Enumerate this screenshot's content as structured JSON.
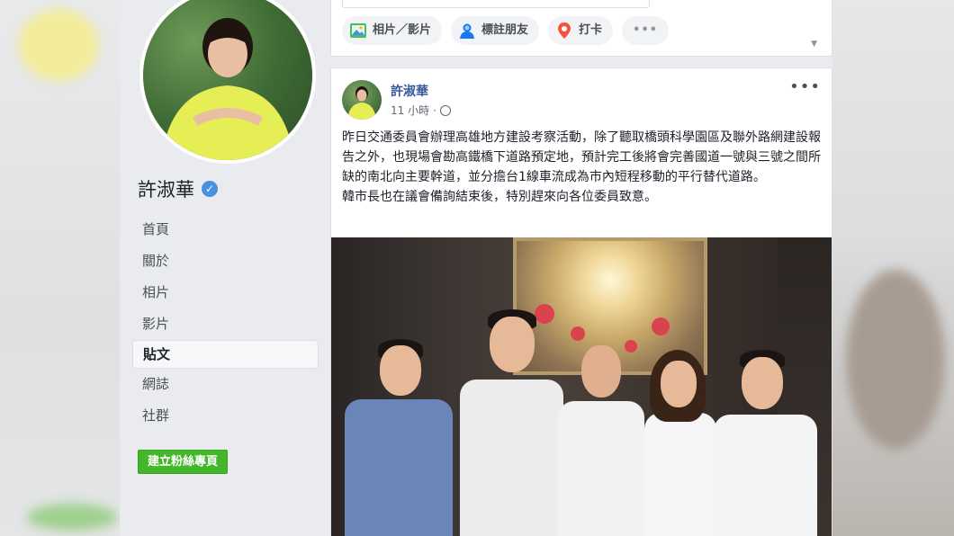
{
  "page": {
    "name": "許淑華",
    "nav": [
      {
        "label": "首頁"
      },
      {
        "label": "關於"
      },
      {
        "label": "相片"
      },
      {
        "label": "影片"
      },
      {
        "label": "貼文"
      },
      {
        "label": "網誌"
      },
      {
        "label": "社群"
      }
    ],
    "active_nav": "貼文",
    "create_page_label": "建立粉絲專頁"
  },
  "composer": {
    "actions": [
      {
        "label": "相片／影片",
        "icon": "photo-icon"
      },
      {
        "label": "標註朋友",
        "icon": "tag-friends-icon"
      },
      {
        "label": "打卡",
        "icon": "location-pin-icon"
      }
    ],
    "more_label": "•••"
  },
  "post": {
    "author": "許淑華",
    "time": "11 小時",
    "more_label": "•••",
    "paragraphs": [
      "昨日交通委員會辦理高雄地方建設考察活動，除了聽取橋頭科學園區及聯外路網建設報告之外，也現場會勘高鐵橋下道路預定地，預計完工後將會完善國道一號與三號之間所缺的南北向主要幹道，並分擔台1線車流成為市內短程移動的平行替代道路。",
      "韓市長也在議會備詢結束後，特別趕來向各位委員致意。"
    ]
  },
  "colors": {
    "link": "#365899",
    "green": "#42b72a",
    "verified": "#4a90e2",
    "background": "#e9ebee"
  }
}
